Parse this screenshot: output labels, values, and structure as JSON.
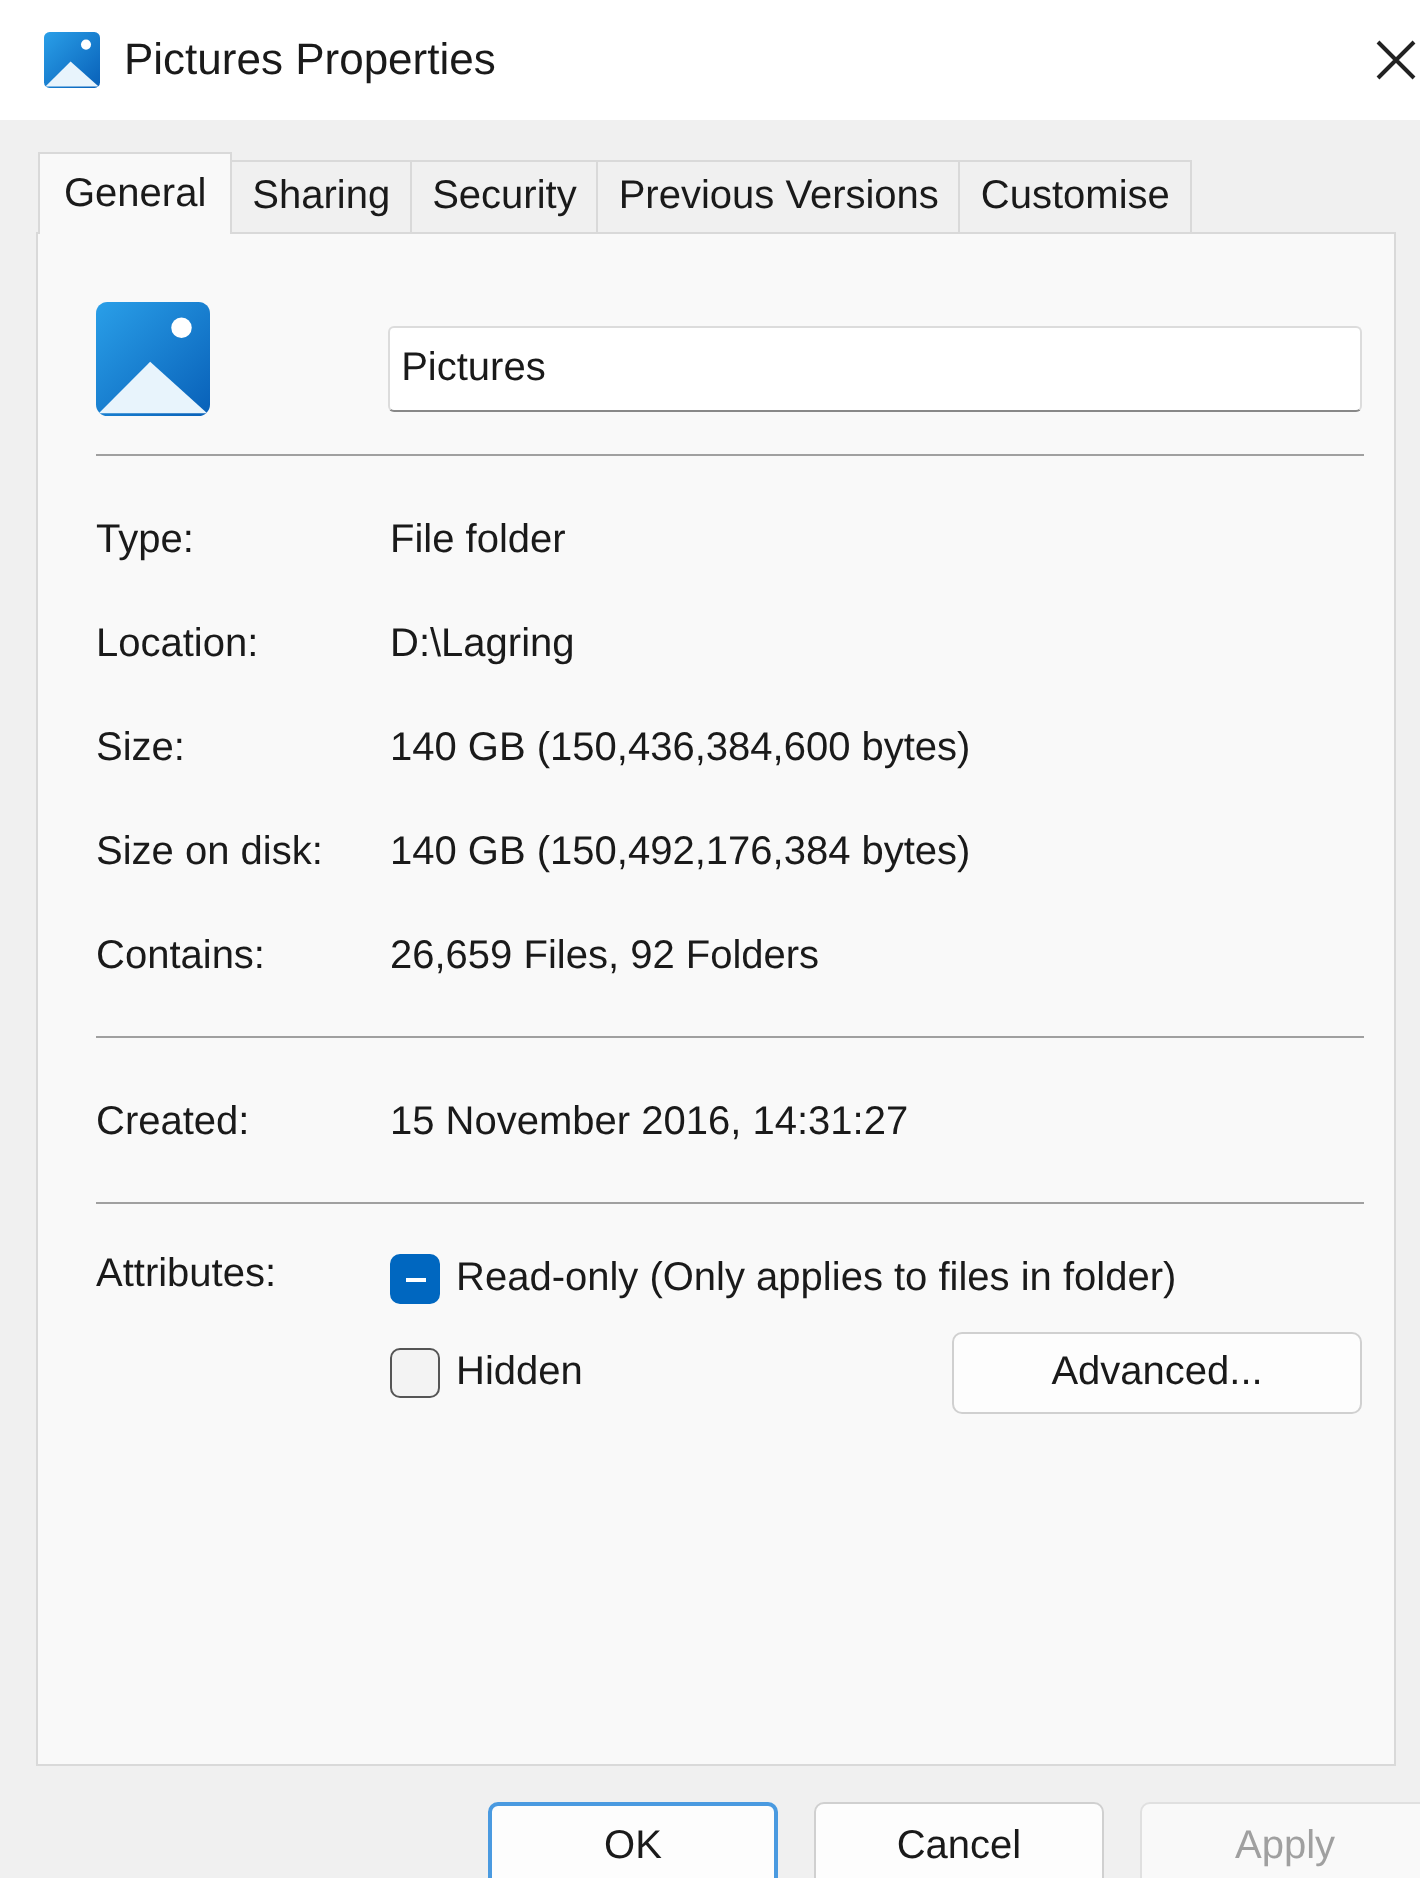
{
  "window": {
    "title": "Pictures Properties"
  },
  "tabs": [
    {
      "label": "General",
      "selected": true
    },
    {
      "label": "Sharing",
      "selected": false
    },
    {
      "label": "Security",
      "selected": false
    },
    {
      "label": "Previous Versions",
      "selected": false
    },
    {
      "label": "Customise",
      "selected": false
    }
  ],
  "name_field": {
    "value": "Pictures"
  },
  "info_groups": [
    [
      {
        "label": "Type:",
        "value": "File folder"
      },
      {
        "label": "Location:",
        "value": "D:\\Lagring"
      },
      {
        "label": "Size:",
        "value": "140 GB (150,436,384,600 bytes)"
      },
      {
        "label": "Size on disk:",
        "value": "140 GB (150,492,176,384 bytes)"
      },
      {
        "label": "Contains:",
        "value": "26,659 Files, 92 Folders"
      }
    ],
    [
      {
        "label": "Created:",
        "value": "15 November 2016, 14:31:27"
      }
    ]
  ],
  "attributes": {
    "label": "Attributes:",
    "items": [
      {
        "label": "Read-only (Only applies to files in folder)",
        "checked": true,
        "indeterminate": true
      },
      {
        "label": "Hidden",
        "checked": false
      }
    ],
    "advanced_button": "Advanced..."
  },
  "buttons": [
    {
      "label": "OK",
      "default": true,
      "disabled": false
    },
    {
      "label": "Cancel",
      "default": false,
      "disabled": false
    },
    {
      "label": "Apply",
      "default": false,
      "disabled": true
    }
  ]
}
